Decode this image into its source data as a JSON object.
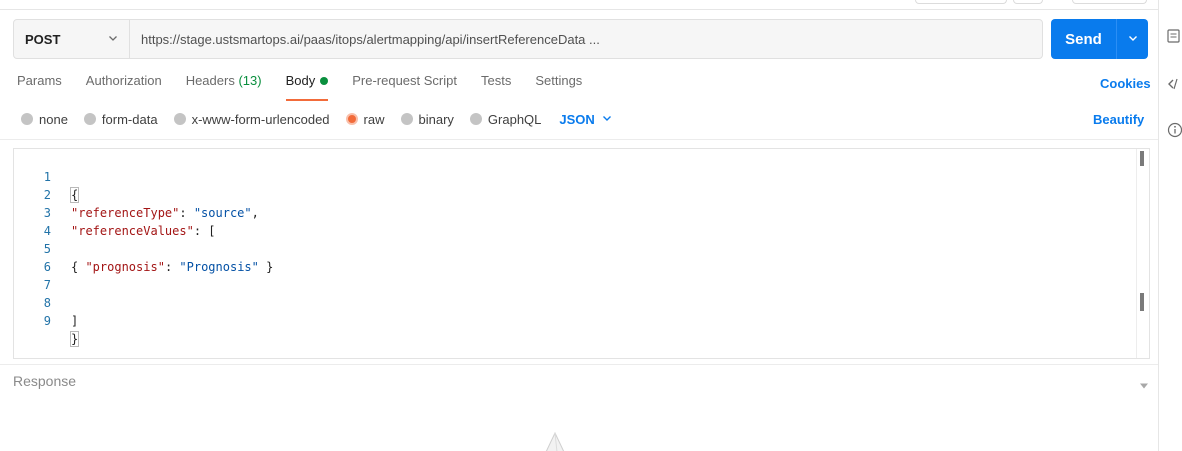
{
  "request": {
    "method": "POST",
    "url": "https://stage.ustsmartops.ai/paas/itops/alertmapping/api/insertReferenceData ...",
    "send_label": "Send"
  },
  "tabs": [
    {
      "label": "Params"
    },
    {
      "label": "Authorization"
    },
    {
      "label": "Headers",
      "count": "(13)"
    },
    {
      "label": "Body",
      "active": true,
      "indicator": "green-dot"
    },
    {
      "label": "Pre-request Script"
    },
    {
      "label": "Tests"
    },
    {
      "label": "Settings"
    }
  ],
  "cookies_label": "Cookies",
  "body_types": [
    {
      "label": "none",
      "selected": false
    },
    {
      "label": "form-data",
      "selected": false
    },
    {
      "label": "x-www-form-urlencoded",
      "selected": false
    },
    {
      "label": "raw",
      "selected": true
    },
    {
      "label": "binary",
      "selected": false
    },
    {
      "label": "GraphQL",
      "selected": false
    }
  ],
  "format": {
    "selected": "JSON"
  },
  "beautify_label": "Beautify",
  "editor": {
    "lines": [
      {
        "n": "1",
        "text": "{"
      },
      {
        "n": "2",
        "text": "\"referenceType\": \"source\","
      },
      {
        "n": "3",
        "text": "\"referenceValues\": ["
      },
      {
        "n": "4",
        "text": ""
      },
      {
        "n": "5",
        "text": "{ \"prognosis\": \"Prognosis\" }"
      },
      {
        "n": "6",
        "text": ""
      },
      {
        "n": "7",
        "text": ""
      },
      {
        "n": "8",
        "text": "]"
      },
      {
        "n": "9",
        "text": "}"
      }
    ]
  },
  "response": {
    "label": "Response"
  },
  "colors": {
    "accent": "#097bed",
    "active_tab_underline": "#f26b3a",
    "success_green": "#0a8f3e",
    "json_key": "#a31515",
    "json_string": "#0451a5",
    "line_number": "#2273a8"
  },
  "icons": {
    "method_dropdown": "chevron-down-icon",
    "send_dropdown": "chevron-down-icon",
    "format_dropdown": "chevron-down-icon",
    "response_toggle": "caret-down-icon",
    "empty_state": "rocket-icon",
    "rail": [
      "documentation-icon",
      "code-icon",
      "info-icon"
    ]
  }
}
